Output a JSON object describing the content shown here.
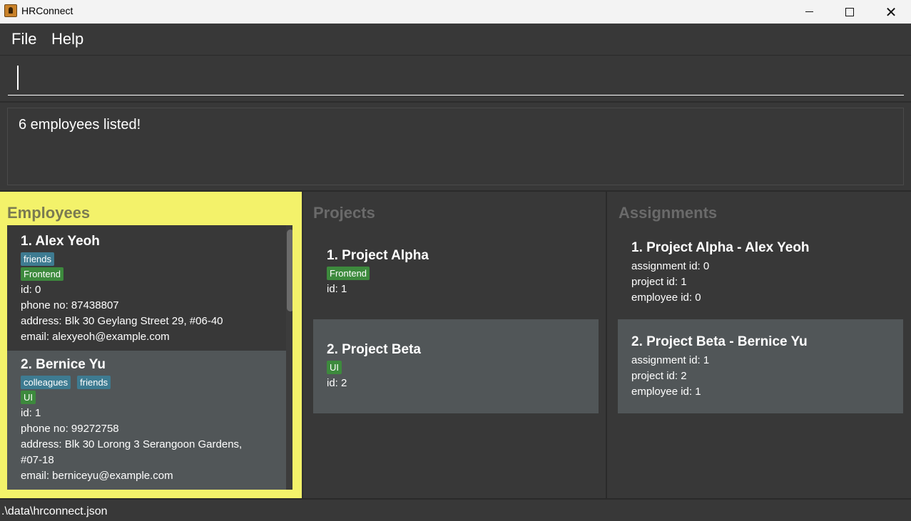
{
  "window": {
    "title": "HRConnect"
  },
  "menu": {
    "file": "File",
    "help": "Help"
  },
  "command": {
    "value": "",
    "placeholder": ""
  },
  "result": {
    "message": "6 employees listed!"
  },
  "panels": {
    "employees_title": "Employees",
    "projects_title": "Projects",
    "assignments_title": "Assignments"
  },
  "employees": [
    {
      "name": "1.  Alex Yeoh",
      "tags": [
        "friends"
      ],
      "roles": [
        "Frontend"
      ],
      "id": "id: 0",
      "phone": "phone no: 87438807",
      "address": "address: Blk 30 Geylang Street 29, #06-40",
      "email": "email: alexyeoh@example.com"
    },
    {
      "name": "2.  Bernice Yu",
      "tags": [
        "colleagues",
        "friends"
      ],
      "roles": [
        "UI"
      ],
      "id": "id: 1",
      "phone": "phone no: 99272758",
      "address": "address: Blk 30 Lorong 3 Serangoon Gardens,",
      "address2": "#07-18",
      "email": "email: berniceyu@example.com"
    }
  ],
  "projects": [
    {
      "name": "1.  Project Alpha",
      "tag": "Frontend",
      "id": "id: 1"
    },
    {
      "name": "2.  Project Beta",
      "tag": "UI",
      "id": "id: 2"
    }
  ],
  "assignments": [
    {
      "title": "1.  Project Alpha - Alex Yeoh",
      "assignment_id": "assignment id: 0",
      "project_id": "project id: 1",
      "employee_id": "employee id: 0"
    },
    {
      "title": "2.  Project Beta - Bernice Yu",
      "assignment_id": "assignment id: 1",
      "project_id": "project id: 2",
      "employee_id": "employee id: 1"
    }
  ],
  "status": {
    "path": ".\\data\\hrconnect.json"
  },
  "colors": {
    "accent_selected_panel": "#f3f26a",
    "tag_blue": "#3e7b91",
    "tag_green": "#3d8a3d",
    "background": "#383838"
  }
}
